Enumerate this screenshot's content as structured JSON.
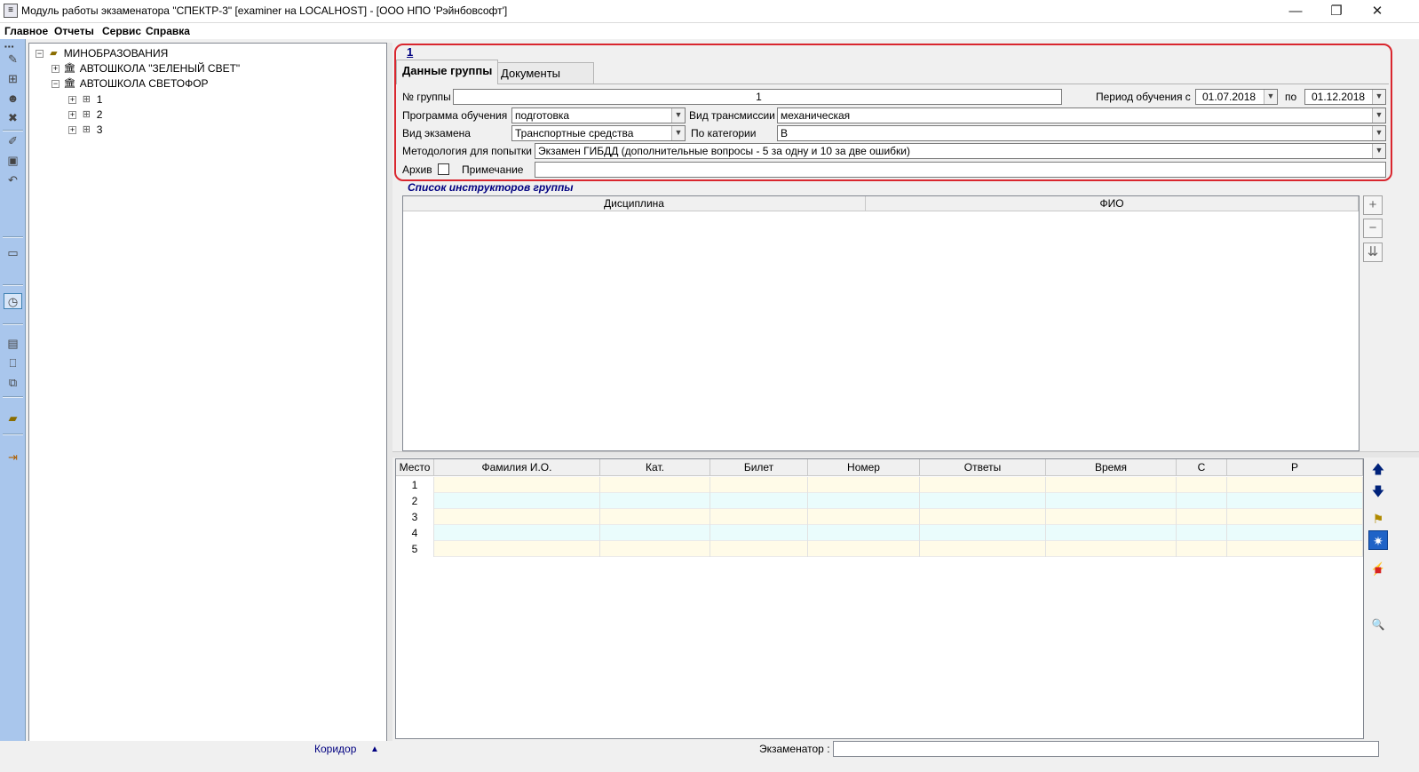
{
  "window": {
    "title": "Модуль работы экзаменатора \"СПЕКТР-3\" [examiner на LOCALHOST] - [ООО НПО 'Рэйнбовсофт']",
    "icon": "app-icon",
    "minimize": "—",
    "restore": "❐",
    "close": "✕"
  },
  "menu": [
    "Главное",
    "Отчеты",
    "Сервис",
    "Справка"
  ],
  "tree": {
    "root": "МИНОБРАЗОВАНИЯ",
    "schools": [
      {
        "name": "АВТОШКОЛА \"ЗЕЛЕНЫЙ СВЕТ\"",
        "expanded": false
      },
      {
        "name": "АВТОШКОЛА СВЕТОФОР",
        "expanded": true,
        "groups": [
          "1",
          "2",
          "3"
        ]
      }
    ]
  },
  "group_form": {
    "link": "1",
    "tabs": [
      "Данные группы",
      "Документы"
    ],
    "group_no_label": "№ группы",
    "group_no": "1",
    "period_label": "Период обучения с",
    "period_from": "01.07.2018",
    "period_to_label": "по",
    "period_to": "01.12.2018",
    "program_label": "Программа обучения",
    "program": "подготовка",
    "transmission_label": "Вид трансмиссии",
    "transmission": "механическая",
    "exam_type_label": "Вид экзамена",
    "exam_type": "Транспортные средства",
    "category_label": "По категории",
    "category": "B",
    "method_label": "Методология для попытки",
    "method": "Экзамен ГИБДД (дополнительные вопросы - 5 за одну и 10 за две ошибки)",
    "archive_label": "Архив",
    "note_label": "Примечание",
    "note": ""
  },
  "instructors": {
    "caption": "Список инструкторов группы",
    "columns": [
      "Дисциплина",
      "ФИО"
    ],
    "buttons": {
      "add": "+",
      "remove": "−",
      "down": "⇊"
    }
  },
  "exam_table": {
    "columns": [
      "Место",
      "Фамилия И.О.",
      "Кат.",
      "Билет",
      "Номер",
      "Ответы",
      "Время",
      "С",
      "Р"
    ],
    "rows": [
      "1",
      "2",
      "3",
      "4",
      "5"
    ],
    "row_colors": [
      "#fffbe8",
      "#eafcfc",
      "#fffbe8",
      "#eafcfc",
      "#fffbe8"
    ]
  },
  "right_buttons": {
    "up": "🡅",
    "down": "🡇",
    "flag": "⚑",
    "settings": "✷",
    "lightning": "⚡",
    "stop": "■",
    "search": "🔍"
  },
  "status": {
    "corridor": "Коридор",
    "corridor_arrow": "▲",
    "examiner_label": "Экзаменатор :",
    "examiner": ""
  },
  "toolbar_icons": [
    "tool-icon",
    "group-icon",
    "person-icon",
    "delete-icon",
    "edit-icon",
    "save-icon",
    "undo-icon",
    "window-icon",
    "clock-icon",
    "monitor-icon",
    "book-icon",
    "link-icon",
    "money-icon",
    "exit-icon"
  ]
}
